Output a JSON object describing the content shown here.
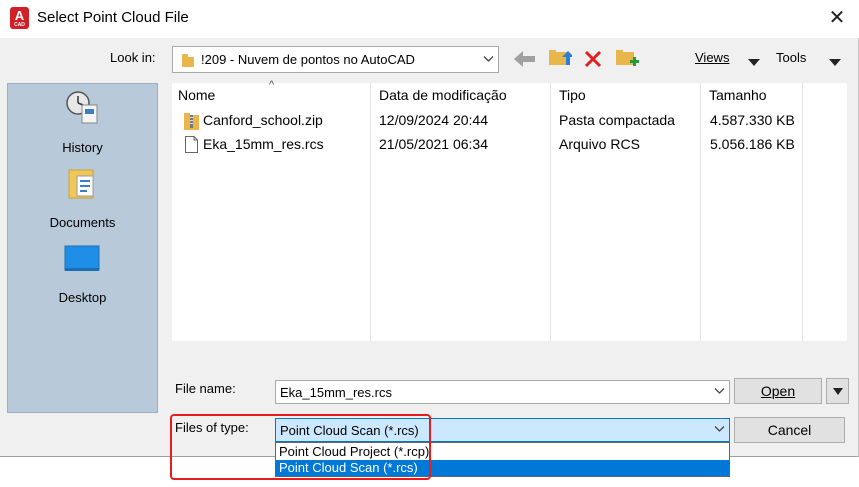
{
  "window": {
    "title": "Select Point Cloud File",
    "close_glyph": "✕",
    "app_icon_letter": "A",
    "app_icon_sub": "CAD"
  },
  "toolbar": {
    "look_in_label": "Look in:",
    "look_in_value": "!209 - Nuvem de pontos no AutoCAD",
    "views_label": "Views",
    "tools_label": "Tools"
  },
  "places": [
    {
      "label": "History",
      "icon": "history-icon"
    },
    {
      "label": "Documents",
      "icon": "documents-icon"
    },
    {
      "label": "Desktop",
      "icon": "desktop-icon"
    }
  ],
  "file_list": {
    "sort_glyph": "^",
    "columns": [
      "Nome",
      "Data de modificação",
      "Tipo",
      "Tamanho"
    ],
    "rows": [
      {
        "name": "Canford_school.zip",
        "date": "12/09/2024 20:44",
        "type": "Pasta compactada",
        "size": "4.587.330 KB",
        "icon": "zip-folder-icon"
      },
      {
        "name": "Eka_15mm_res.rcs",
        "date": "21/05/2021 06:34",
        "type": "Arquivo RCS",
        "size": "5.056.186 KB",
        "icon": "file-icon"
      }
    ]
  },
  "form": {
    "file_name_label": "File name:",
    "file_name_value": "Eka_15mm_res.rcs",
    "files_of_type_label": "Files of type:",
    "files_of_type_value": "Point Cloud Scan (*.rcs)",
    "open_label": "Open",
    "cancel_label": "Cancel",
    "type_options": [
      "Point Cloud Project (*.rcp)",
      "Point Cloud Scan (*.rcs)"
    ],
    "selected_option_index": 1
  },
  "colors": {
    "accent_selection": "#0078d7",
    "highlight_box": "#e81c1c",
    "places_bg": "#b8c9d9"
  }
}
